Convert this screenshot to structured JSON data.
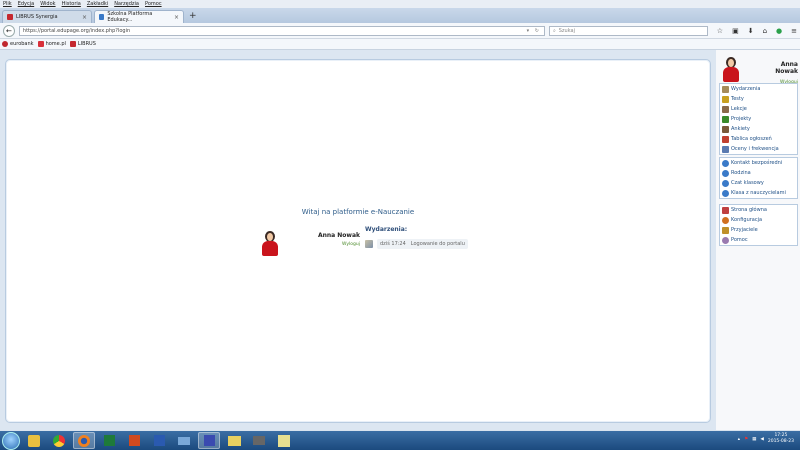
{
  "menubar": [
    "Plik",
    "Edycja",
    "Widok",
    "Historia",
    "Zakładki",
    "Narzędzia",
    "Pomoc"
  ],
  "tabs": [
    {
      "label": "LIBRUS Synergia",
      "active": false
    },
    {
      "label": "Szkolna Platforma Edukacy...",
      "active": true
    }
  ],
  "url": "https://portal.edupage.org/index.php?login",
  "search_placeholder": "Szukaj",
  "bookmarks": [
    "eurobank",
    "home.pl",
    "LIBRUS"
  ],
  "welcome": "Witaj na platformie e-Nauczanie",
  "user": {
    "name": "Anna Nowak",
    "logout": "Wyloguj",
    "first": "Anna",
    "last": "Nowak"
  },
  "events": {
    "title": "Wydarzenia:",
    "items": [
      {
        "time": "dziś 17:24",
        "text": "Logowanie do portalu"
      }
    ]
  },
  "sidebar": {
    "group1": [
      {
        "label": "Wydarzenia",
        "icon": "events-icon",
        "color": "#a58b5a"
      },
      {
        "label": "Testy",
        "icon": "tests-icon",
        "color": "#c8a020"
      },
      {
        "label": "Lekcje",
        "icon": "lessons-icon",
        "color": "#8a6a4a"
      },
      {
        "label": "Projekty",
        "icon": "projects-icon",
        "color": "#3a8a2a"
      },
      {
        "label": "Ankiety",
        "icon": "surveys-icon",
        "color": "#7a5a3a"
      },
      {
        "label": "Tablica ogłoszeń",
        "icon": "noticeboard-icon",
        "color": "#c04030"
      },
      {
        "label": "Oceny i frekwencja",
        "icon": "grades-icon",
        "color": "#5a7ab0"
      }
    ],
    "group2": [
      {
        "label": "Kontakt bezpośredni",
        "icon": "contact-icon",
        "color": "#3a7ac8"
      },
      {
        "label": "Rodzina",
        "icon": "family-icon",
        "color": "#3a7ac8"
      },
      {
        "label": "Czat klasowy",
        "icon": "chat-icon",
        "color": "#3a7ac8"
      },
      {
        "label": "Klasa z nauczycielami",
        "icon": "class-icon",
        "color": "#3a7ac8"
      }
    ],
    "group3": [
      {
        "label": "Strona główna",
        "icon": "home-icon",
        "color": "#c04040"
      },
      {
        "label": "Konfiguracja",
        "icon": "settings-icon",
        "color": "#d07020"
      },
      {
        "label": "Przyjaciele",
        "icon": "friends-icon",
        "color": "#c0902a"
      },
      {
        "label": "Pomoc",
        "icon": "help-icon",
        "color": "#9a7ab0"
      }
    ]
  },
  "clock": {
    "time": "17:25",
    "date": "2015-08-23"
  }
}
